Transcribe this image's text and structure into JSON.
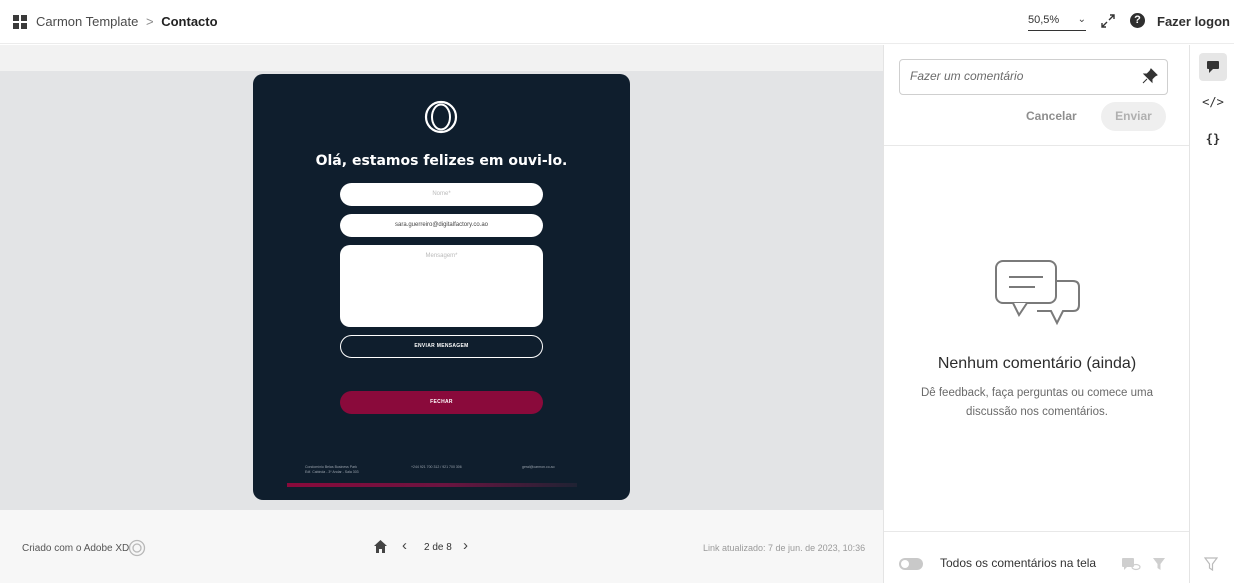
{
  "header": {
    "project": "Carmon Template",
    "separator": ">",
    "page": "Contacto",
    "zoom": "50,5%",
    "signin": "Fazer logon"
  },
  "artboard": {
    "title": "Olá, estamos felizes em ouvi-lo.",
    "name_placeholder": "Nome*",
    "email_value": "sara.guerreiro@digitalfactory.co.ao",
    "message_placeholder": "Mensagem*",
    "send_label": "ENVIAR MENSAGEM",
    "close_label": "FECHAR",
    "footer_address": "Condomínio Belas Business Park\nEdf. Cabinda - 3º Andar - Sala 303",
    "footer_phone": "+244 921 700 312 / 921 700 306",
    "footer_email": "geral@carmon.co.ao"
  },
  "bottom": {
    "made_with": "Criado com o Adobe XD",
    "pages": "2 de 8",
    "updated": "Link atualizado: 7 de jun. de 2023, 10:36"
  },
  "comments": {
    "input_placeholder": "Fazer um comentário",
    "cancel": "Cancelar",
    "send": "Enviar",
    "empty_title": "Nenhum comentário (ainda)",
    "empty_text": "Dê feedback, faça perguntas ou comece uma discussão nos comentários.",
    "all_on_screen": "Todos os comentários na tela"
  },
  "rail": {
    "code_label": "</>",
    "json_label": "{}"
  },
  "colors": {
    "artboard_bg": "#0f1e2d",
    "accent_button": "#8a0a3b"
  }
}
